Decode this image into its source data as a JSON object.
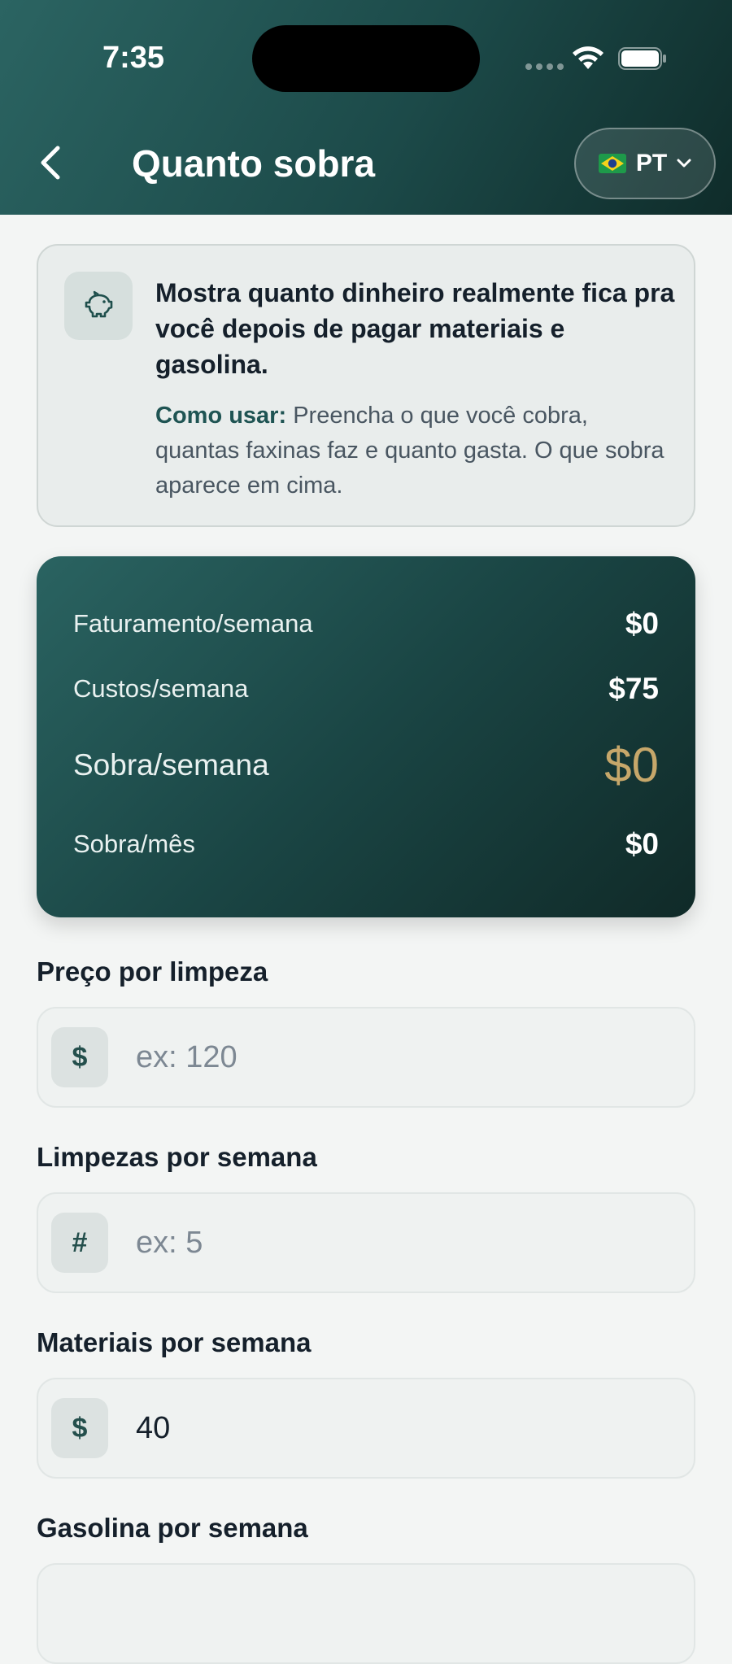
{
  "status_bar": {
    "time": "7:35"
  },
  "header": {
    "title": "Quanto sobra",
    "language": "PT",
    "flag": "brazil-flag-icon",
    "back_icon": "chevron-left-icon"
  },
  "info_card": {
    "icon": "piggy-bank-icon",
    "heading": "Mostra quanto dinheiro realmente fica pra você depois de pagar materiais e gasolina.",
    "how_to_label": "Como usar:",
    "how_to_text": " Preencha o que você cobra, quantas faxinas faz e quanto gasta. O que sobra aparece em cima."
  },
  "summary": {
    "revenue_label": "Faturamento/semana",
    "revenue_value": "$0",
    "costs_label": "Custos/semana",
    "costs_value": "$75",
    "leftover_week_label": "Sobra/semana",
    "leftover_week_value": "$0",
    "leftover_month_label": "Sobra/mês",
    "leftover_month_value": "$0"
  },
  "form": {
    "price": {
      "label": "Preço por limpeza",
      "prefix": "$",
      "value": "",
      "placeholder": "ex: 120"
    },
    "cleanings": {
      "label": "Limpezas por semana",
      "prefix": "#",
      "value": "",
      "placeholder": "ex: 5"
    },
    "materials": {
      "label": "Materiais por semana",
      "prefix": "$",
      "value": "40",
      "placeholder": ""
    },
    "gas": {
      "label": "Gasolina por semana"
    }
  },
  "colors": {
    "header_dark": "#1c4a49",
    "accent_gold": "#c6a76a",
    "background": "#f3f5f4"
  }
}
